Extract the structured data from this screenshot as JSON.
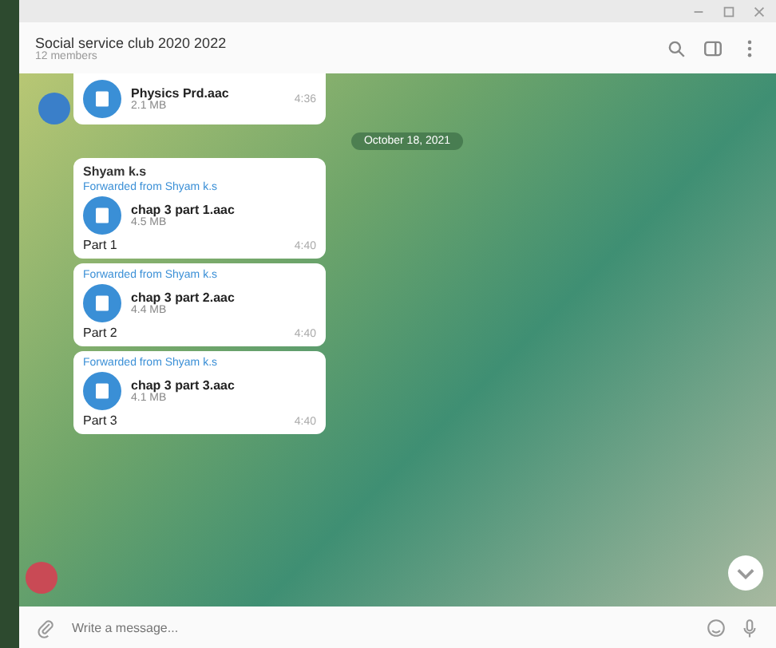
{
  "header": {
    "title": "Social service club 2020 2022",
    "subtitle": "12 members"
  },
  "top_message": {
    "file": "Physics Prd.aac",
    "size": "2.1 MB",
    "time": "4:36"
  },
  "date": "October 18, 2021",
  "messages": [
    {
      "sender": "Shyam k.s",
      "forwarded": "Forwarded from Shyam k.s",
      "file": "chap 3 part 1.aac",
      "size": "4.5 MB",
      "caption": "Part 1",
      "time": "4:40"
    },
    {
      "forwarded": "Forwarded from Shyam k.s",
      "file": "chap 3 part 2.aac",
      "size": "4.4 MB",
      "caption": "Part 2",
      "time": "4:40"
    },
    {
      "forwarded": "Forwarded from Shyam k.s",
      "file": "chap 3 part 3.aac",
      "size": "4.1 MB",
      "caption": "Part 3",
      "time": "4:40"
    }
  ],
  "composer": {
    "placeholder": "Write a message..."
  }
}
